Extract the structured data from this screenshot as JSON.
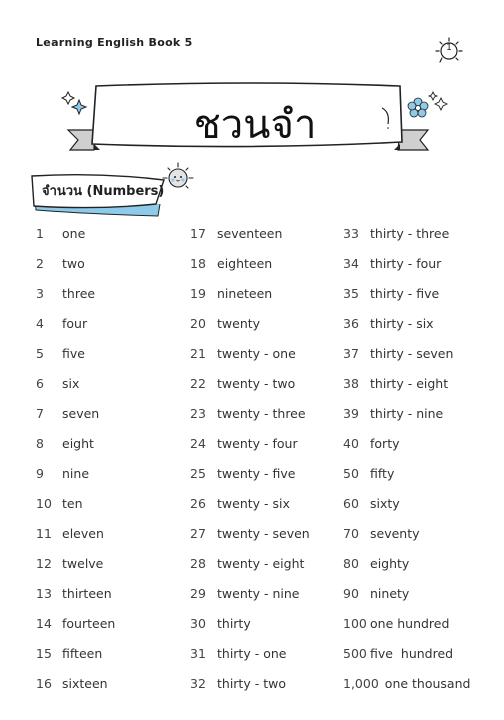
{
  "header": {
    "title": "Learning English Book 5",
    "page_number": "1"
  },
  "banner": {
    "title": "ชวนจำ",
    "icons": [
      "sparkle-icon",
      "flower-icon"
    ]
  },
  "section": {
    "label": "จำนวน (Numbers)",
    "icon": "sun-face-icon"
  },
  "colors": {
    "accent_blue": "#8ecbea",
    "ribbon_gray": "#cfcfcf",
    "text": "#333333"
  },
  "columns": [
    [
      {
        "n": "1",
        "w": "one"
      },
      {
        "n": "2",
        "w": "two"
      },
      {
        "n": "3",
        "w": "three"
      },
      {
        "n": "4",
        "w": "four"
      },
      {
        "n": "5",
        "w": "five"
      },
      {
        "n": "6",
        "w": "six"
      },
      {
        "n": "7",
        "w": "seven"
      },
      {
        "n": "8",
        "w": "eight"
      },
      {
        "n": "9",
        "w": "nine"
      },
      {
        "n": "10",
        "w": "ten"
      },
      {
        "n": "11",
        "w": "eleven"
      },
      {
        "n": "12",
        "w": "twelve"
      },
      {
        "n": "13",
        "w": "thirteen"
      },
      {
        "n": "14",
        "w": "fourteen"
      },
      {
        "n": "15",
        "w": "fifteen"
      },
      {
        "n": "16",
        "w": "sixteen"
      }
    ],
    [
      {
        "n": "17",
        "w": "seventeen"
      },
      {
        "n": "18",
        "w": "eighteen"
      },
      {
        "n": "19",
        "w": "nineteen"
      },
      {
        "n": "20",
        "w": "twenty"
      },
      {
        "n": "21",
        "w": "twenty - one"
      },
      {
        "n": "22",
        "w": "twenty - two"
      },
      {
        "n": "23",
        "w": "twenty - three"
      },
      {
        "n": "24",
        "w": "twenty - four"
      },
      {
        "n": "25",
        "w": "twenty - five"
      },
      {
        "n": "26",
        "w": "twenty - six"
      },
      {
        "n": "27",
        "w": "twenty - seven"
      },
      {
        "n": "28",
        "w": "twenty - eight"
      },
      {
        "n": "29",
        "w": "twenty - nine"
      },
      {
        "n": "30",
        "w": "thirty"
      },
      {
        "n": "31",
        "w": "thirty - one"
      },
      {
        "n": "32",
        "w": "thirty - two"
      }
    ],
    [
      {
        "n": "33",
        "w": "thirty - three"
      },
      {
        "n": "34",
        "w": "thirty - four"
      },
      {
        "n": "35",
        "w": "thirty - five"
      },
      {
        "n": "36",
        "w": "thirty - six"
      },
      {
        "n": "37",
        "w": "thirty - seven"
      },
      {
        "n": "38",
        "w": "thirty - eight"
      },
      {
        "n": "39",
        "w": "thirty - nine"
      },
      {
        "n": "40",
        "w": "forty"
      },
      {
        "n": "50",
        "w": "fifty"
      },
      {
        "n": "60",
        "w": "sixty"
      },
      {
        "n": "70",
        "w": "seventy"
      },
      {
        "n": "80",
        "w": "eighty"
      },
      {
        "n": "90",
        "w": "ninety"
      },
      {
        "n": "100",
        "w": "one hundred"
      },
      {
        "n": "500",
        "w": "five  hundred"
      },
      {
        "n": "1,000",
        "w": "one thousand"
      }
    ]
  ]
}
